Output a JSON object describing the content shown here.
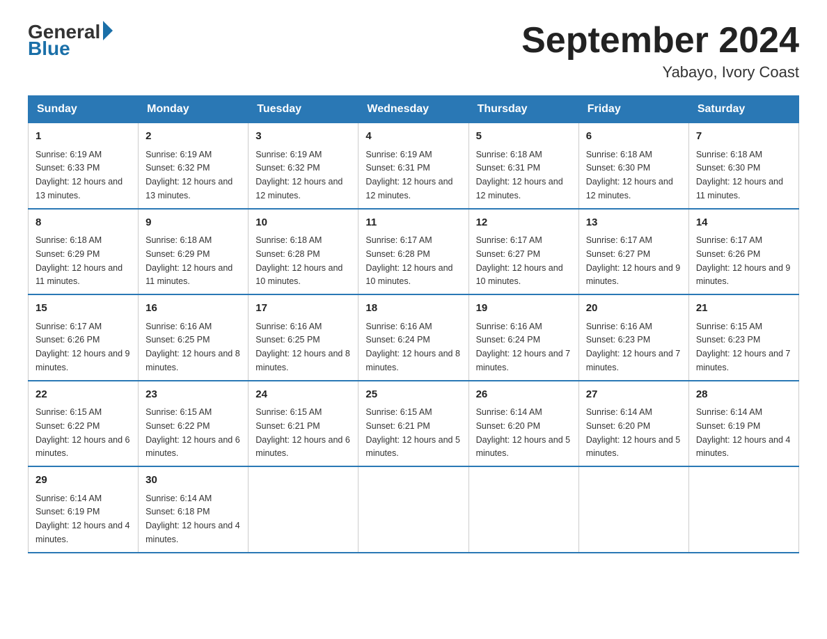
{
  "logo": {
    "general": "General",
    "blue": "Blue"
  },
  "header": {
    "title": "September 2024",
    "subtitle": "Yabayo, Ivory Coast"
  },
  "weekdays": [
    "Sunday",
    "Monday",
    "Tuesday",
    "Wednesday",
    "Thursday",
    "Friday",
    "Saturday"
  ],
  "weeks": [
    [
      {
        "day": "1",
        "sunrise": "6:19 AM",
        "sunset": "6:33 PM",
        "daylight": "12 hours and 13 minutes."
      },
      {
        "day": "2",
        "sunrise": "6:19 AM",
        "sunset": "6:32 PM",
        "daylight": "12 hours and 13 minutes."
      },
      {
        "day": "3",
        "sunrise": "6:19 AM",
        "sunset": "6:32 PM",
        "daylight": "12 hours and 12 minutes."
      },
      {
        "day": "4",
        "sunrise": "6:19 AM",
        "sunset": "6:31 PM",
        "daylight": "12 hours and 12 minutes."
      },
      {
        "day": "5",
        "sunrise": "6:18 AM",
        "sunset": "6:31 PM",
        "daylight": "12 hours and 12 minutes."
      },
      {
        "day": "6",
        "sunrise": "6:18 AM",
        "sunset": "6:30 PM",
        "daylight": "12 hours and 12 minutes."
      },
      {
        "day": "7",
        "sunrise": "6:18 AM",
        "sunset": "6:30 PM",
        "daylight": "12 hours and 11 minutes."
      }
    ],
    [
      {
        "day": "8",
        "sunrise": "6:18 AM",
        "sunset": "6:29 PM",
        "daylight": "12 hours and 11 minutes."
      },
      {
        "day": "9",
        "sunrise": "6:18 AM",
        "sunset": "6:29 PM",
        "daylight": "12 hours and 11 minutes."
      },
      {
        "day": "10",
        "sunrise": "6:18 AM",
        "sunset": "6:28 PM",
        "daylight": "12 hours and 10 minutes."
      },
      {
        "day": "11",
        "sunrise": "6:17 AM",
        "sunset": "6:28 PM",
        "daylight": "12 hours and 10 minutes."
      },
      {
        "day": "12",
        "sunrise": "6:17 AM",
        "sunset": "6:27 PM",
        "daylight": "12 hours and 10 minutes."
      },
      {
        "day": "13",
        "sunrise": "6:17 AM",
        "sunset": "6:27 PM",
        "daylight": "12 hours and 9 minutes."
      },
      {
        "day": "14",
        "sunrise": "6:17 AM",
        "sunset": "6:26 PM",
        "daylight": "12 hours and 9 minutes."
      }
    ],
    [
      {
        "day": "15",
        "sunrise": "6:17 AM",
        "sunset": "6:26 PM",
        "daylight": "12 hours and 9 minutes."
      },
      {
        "day": "16",
        "sunrise": "6:16 AM",
        "sunset": "6:25 PM",
        "daylight": "12 hours and 8 minutes."
      },
      {
        "day": "17",
        "sunrise": "6:16 AM",
        "sunset": "6:25 PM",
        "daylight": "12 hours and 8 minutes."
      },
      {
        "day": "18",
        "sunrise": "6:16 AM",
        "sunset": "6:24 PM",
        "daylight": "12 hours and 8 minutes."
      },
      {
        "day": "19",
        "sunrise": "6:16 AM",
        "sunset": "6:24 PM",
        "daylight": "12 hours and 7 minutes."
      },
      {
        "day": "20",
        "sunrise": "6:16 AM",
        "sunset": "6:23 PM",
        "daylight": "12 hours and 7 minutes."
      },
      {
        "day": "21",
        "sunrise": "6:15 AM",
        "sunset": "6:23 PM",
        "daylight": "12 hours and 7 minutes."
      }
    ],
    [
      {
        "day": "22",
        "sunrise": "6:15 AM",
        "sunset": "6:22 PM",
        "daylight": "12 hours and 6 minutes."
      },
      {
        "day": "23",
        "sunrise": "6:15 AM",
        "sunset": "6:22 PM",
        "daylight": "12 hours and 6 minutes."
      },
      {
        "day": "24",
        "sunrise": "6:15 AM",
        "sunset": "6:21 PM",
        "daylight": "12 hours and 6 minutes."
      },
      {
        "day": "25",
        "sunrise": "6:15 AM",
        "sunset": "6:21 PM",
        "daylight": "12 hours and 5 minutes."
      },
      {
        "day": "26",
        "sunrise": "6:14 AM",
        "sunset": "6:20 PM",
        "daylight": "12 hours and 5 minutes."
      },
      {
        "day": "27",
        "sunrise": "6:14 AM",
        "sunset": "6:20 PM",
        "daylight": "12 hours and 5 minutes."
      },
      {
        "day": "28",
        "sunrise": "6:14 AM",
        "sunset": "6:19 PM",
        "daylight": "12 hours and 4 minutes."
      }
    ],
    [
      {
        "day": "29",
        "sunrise": "6:14 AM",
        "sunset": "6:19 PM",
        "daylight": "12 hours and 4 minutes."
      },
      {
        "day": "30",
        "sunrise": "6:14 AM",
        "sunset": "6:18 PM",
        "daylight": "12 hours and 4 minutes."
      },
      null,
      null,
      null,
      null,
      null
    ]
  ],
  "labels": {
    "sunrise": "Sunrise:",
    "sunset": "Sunset:",
    "daylight": "Daylight:"
  }
}
